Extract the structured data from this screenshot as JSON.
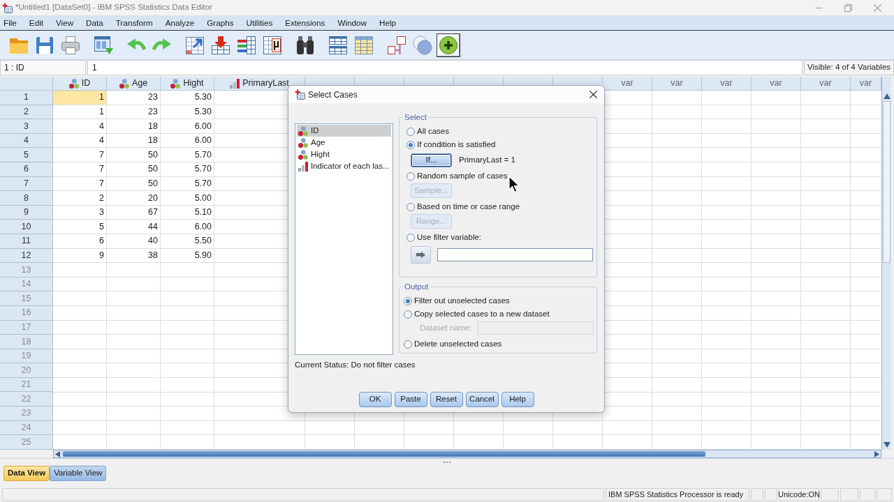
{
  "window": {
    "title": "*Untitled1 [DataSet0] - IBM SPSS Statistics Data Editor"
  },
  "menu": [
    "File",
    "Edit",
    "View",
    "Data",
    "Transform",
    "Analyze",
    "Graphs",
    "Utilities",
    "Extensions",
    "Window",
    "Help"
  ],
  "toolbar": [
    [
      {
        "kind": "folder",
        "pressed": false
      },
      {
        "kind": "floppy",
        "pressed": false
      },
      {
        "kind": "printer",
        "pressed": false
      }
    ],
    [
      {
        "kind": "recall",
        "pressed": false
      }
    ],
    [
      {
        "kind": "undo",
        "pressed": false
      },
      {
        "kind": "redo",
        "pressed": false
      }
    ],
    [
      {
        "kind": "goto",
        "pressed": false
      },
      {
        "kind": "insert",
        "pressed": false
      },
      {
        "kind": "bars",
        "pressed": false
      },
      {
        "kind": "mu",
        "pressed": false
      }
    ],
    [
      {
        "kind": "binoculars",
        "pressed": false
      }
    ],
    [
      {
        "kind": "split",
        "pressed": false
      },
      {
        "kind": "weight",
        "pressed": false
      }
    ],
    [
      {
        "kind": "labels",
        "pressed": false
      },
      {
        "kind": "circles",
        "pressed": false
      },
      {
        "kind": "plus",
        "pressed": true
      }
    ]
  ],
  "cell_editor": {
    "cell": "1 : ID",
    "value": "1",
    "visible": "Visible: 4 of 4 Variables"
  },
  "grid": {
    "columns": [
      {
        "name": "ID",
        "kind": "nominal"
      },
      {
        "name": "Age",
        "kind": "nominal"
      },
      {
        "name": "Hight",
        "kind": "nominal"
      },
      {
        "name": "PrimaryLast",
        "kind": "ordinal"
      }
    ],
    "var_columns": [
      "var",
      "var",
      "var",
      "var",
      "var",
      "var"
    ],
    "rows": [
      {
        "number": "1",
        "cells": [
          {
            "value": "1",
            "selected": true
          },
          {
            "value": "23",
            "selected": false
          },
          {
            "value": "5.30",
            "selected": false
          }
        ]
      },
      {
        "number": "2",
        "cells": [
          {
            "value": "1",
            "selected": false
          },
          {
            "value": "23",
            "selected": false
          },
          {
            "value": "5.30",
            "selected": false
          }
        ]
      },
      {
        "number": "3",
        "cells": [
          {
            "value": "4",
            "selected": false
          },
          {
            "value": "18",
            "selected": false
          },
          {
            "value": "6.00",
            "selected": false
          }
        ]
      },
      {
        "number": "4",
        "cells": [
          {
            "value": "4",
            "selected": false
          },
          {
            "value": "18",
            "selected": false
          },
          {
            "value": "6.00",
            "selected": false
          }
        ]
      },
      {
        "number": "5",
        "cells": [
          {
            "value": "7",
            "selected": false
          },
          {
            "value": "50",
            "selected": false
          },
          {
            "value": "5.70",
            "selected": false
          }
        ]
      },
      {
        "number": "6",
        "cells": [
          {
            "value": "7",
            "selected": false
          },
          {
            "value": "50",
            "selected": false
          },
          {
            "value": "5.70",
            "selected": false
          }
        ]
      },
      {
        "number": "7",
        "cells": [
          {
            "value": "7",
            "selected": false
          },
          {
            "value": "50",
            "selected": false
          },
          {
            "value": "5.70",
            "selected": false
          }
        ]
      },
      {
        "number": "8",
        "cells": [
          {
            "value": "2",
            "selected": false
          },
          {
            "value": "20",
            "selected": false
          },
          {
            "value": "5.00",
            "selected": false
          }
        ]
      },
      {
        "number": "9",
        "cells": [
          {
            "value": "3",
            "selected": false
          },
          {
            "value": "67",
            "selected": false
          },
          {
            "value": "5.10",
            "selected": false
          }
        ]
      },
      {
        "number": "10",
        "cells": [
          {
            "value": "5",
            "selected": false
          },
          {
            "value": "44",
            "selected": false
          },
          {
            "value": "6.00",
            "selected": false
          }
        ]
      },
      {
        "number": "11",
        "cells": [
          {
            "value": "6",
            "selected": false
          },
          {
            "value": "40",
            "selected": false
          },
          {
            "value": "5.50",
            "selected": false
          }
        ]
      },
      {
        "number": "12",
        "cells": [
          {
            "value": "9",
            "selected": false
          },
          {
            "value": "38",
            "selected": false
          },
          {
            "value": "5.90",
            "selected": false
          }
        ]
      },
      {
        "number": "13"
      },
      {
        "number": "14"
      },
      {
        "number": "15"
      },
      {
        "number": "16"
      },
      {
        "number": "17"
      },
      {
        "number": "18"
      },
      {
        "number": "19"
      },
      {
        "number": "20"
      },
      {
        "number": "21"
      },
      {
        "number": "22"
      },
      {
        "number": "23"
      },
      {
        "number": "24"
      },
      {
        "number": "25"
      }
    ]
  },
  "dialog": {
    "title": "Select Cases",
    "variables": [
      {
        "name": "ID",
        "kind": "nominal",
        "selected": true
      },
      {
        "name": "Age",
        "kind": "nominal",
        "selected": false
      },
      {
        "name": "Hight",
        "kind": "nominal",
        "selected": false
      },
      {
        "name": "Indicator of each las...",
        "kind": "ordinal",
        "selected": false
      }
    ],
    "select": {
      "legend": "Select",
      "options": [
        {
          "kind": "plain",
          "label": "All cases",
          "selected": false
        },
        {
          "kind": "button",
          "label": "If condition is satisfied",
          "selected": true,
          "button": {
            "label": "If...",
            "disabled": false,
            "focused": true
          },
          "condition": "PrimaryLast = 1"
        },
        {
          "kind": "button",
          "label": "Random sample of cases",
          "selected": false,
          "button": {
            "label": "Sample...",
            "disabled": true,
            "focused": false
          }
        },
        {
          "kind": "button",
          "label": "Based on time or case range",
          "selected": false,
          "button": {
            "label": "Range...",
            "disabled": true,
            "focused": false
          }
        },
        {
          "kind": "filter",
          "label": "Use filter variable:",
          "selected": false
        }
      ]
    },
    "output": {
      "legend": "Output",
      "options": [
        {
          "kind": "plain",
          "label": "Filter out unselected cases",
          "selected": true
        },
        {
          "kind": "dataset",
          "label": "Copy selected cases to a new dataset",
          "selected": false,
          "field_label": "Dataset name:",
          "field_disabled": true
        },
        {
          "kind": "plain",
          "label": "Delete unselected cases",
          "selected": false
        }
      ]
    },
    "status": "Current Status: Do not filter cases",
    "buttons": [
      "OK",
      "Paste",
      "Reset",
      "Cancel",
      "Help"
    ]
  },
  "view_tabs": [
    {
      "label": "Data View",
      "selected": true
    },
    {
      "label": "Variable View",
      "selected": false
    }
  ],
  "status_bar": {
    "message": "IBM SPSS Statistics Processor is ready",
    "encoding": "Unicode:ON"
  }
}
